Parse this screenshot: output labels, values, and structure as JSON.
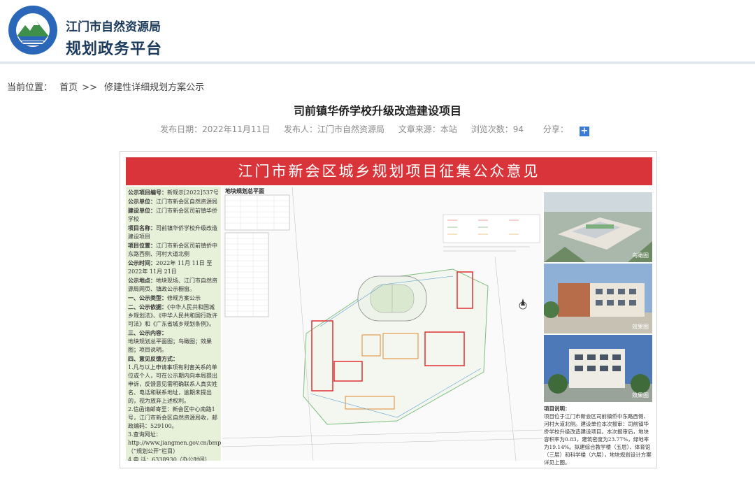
{
  "header": {
    "logo_text": "江门自然资源",
    "org_name": "江门市自然资源局",
    "platform_name": "规划政务平台"
  },
  "breadcrumb": {
    "label": "当前位置：",
    "home": "首页",
    "separator": ">>",
    "current": "修建性详细规划方案公示"
  },
  "article": {
    "title": "司前镇华侨学校升级改造建设项目",
    "publish_date": "发布日期：2022年11月11日",
    "publisher": "发布人：江门市自然资源局",
    "source": "文章来源：本站",
    "views": "浏览次数：94",
    "share_label": "分享："
  },
  "poster": {
    "banner": "江门市新会区城乡规划项目征集公众意见",
    "info": [
      {
        "b": "公示项目编号：",
        "t": "新规示[2022]537号"
      },
      {
        "b": "公示单位：",
        "t": "江门市新会区自然资源局"
      },
      {
        "b": "建设单位：",
        "t": "江门市新会区司前镇华侨学校"
      },
      {
        "b": "项目名称：",
        "t": "司前镇华侨学校升级改造建设项目"
      },
      {
        "b": "项目位置：",
        "t": "江门市新会区司前镇侨中东路西侧、河村大道北侧"
      },
      {
        "b": "公示时间：",
        "t": "2022年 11月 11日 至 2022年 11月 21日"
      },
      {
        "b": "公示地点：",
        "t": "地块现场、江门市自然资源局网页、镇政公示橱窗。"
      },
      {
        "b": "一、公示类型：",
        "t": "修规方案公示"
      },
      {
        "b": "二、公示依据：",
        "t": "《中华人民共和国城乡规划法》、《中华人民共和国行政许可法》和《广东省城乡规划条例》。"
      },
      {
        "b": "三、公示内容：",
        "t": ""
      },
      {
        "b": "",
        "t": "地块规划总平面图；鸟瞰图；效果图；项目说明。"
      },
      {
        "b": "四、意见反馈方式：",
        "t": ""
      },
      {
        "b": "",
        "t": "1.凡与以上申请事项有利害关系的单位或个人，可在公示期内向本局提出申诉，反馈意见需明确联系人真实姓名、电话和联系地址，逾期未提出的，视为放弃上述权利。"
      },
      {
        "b": "",
        "t": "2.信函请邮寄至：新会区中心南路1号，江门市新会区自然资源局收，邮政编码：529100。"
      },
      {
        "b": "",
        "t": "3.查询网址：http://www.jiangmen.gov.cn/bmpd/jmszrzyj/（“规划公开”栏目）"
      },
      {
        "b": "",
        "t": "4.电 话：6338930（办公时间）"
      }
    ],
    "plan_title": "地块规划总平面",
    "render_captions": [
      "鸟瞰图",
      "效果图",
      "效果图"
    ],
    "desc_title": "项目说明：",
    "desc_text": "项目位于江门市新会区司前镇侨中东路西侧、河村大道北侧。建设单位本次报审：司前镇华侨学校升级改造建设项目。本次报审后，地块容积率为0.83，建筑密度为23.77%，绿地率为19.14%。拟建综合教学楼（五层）、体育馆（三层）和科学楼（六层），地块规划设计方案详见上图。"
  }
}
